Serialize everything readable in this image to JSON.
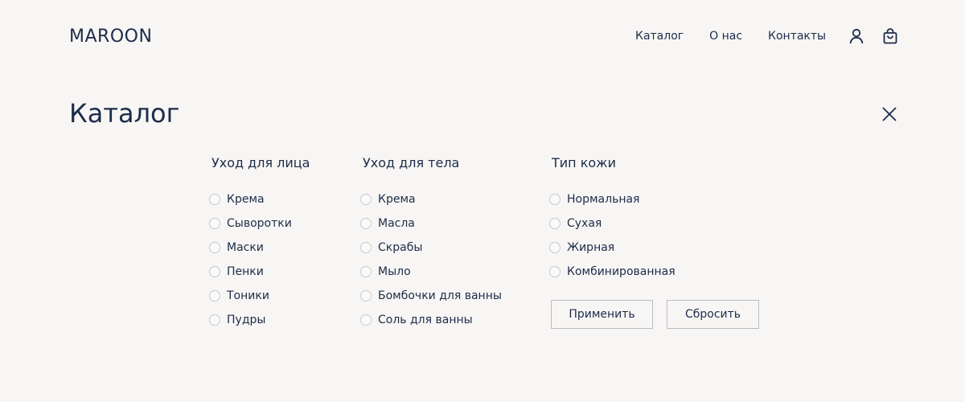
{
  "header": {
    "logo": "MAROON",
    "nav": [
      "Каталог",
      "О нас",
      "Контакты"
    ],
    "icons": [
      "user-icon",
      "shopping-bag-icon"
    ]
  },
  "catalog": {
    "title": "Каталог",
    "close_icon": "close-icon",
    "groups": [
      {
        "title": "Уход для лица",
        "options": [
          "Крема",
          "Сыворотки",
          "Маски",
          "Пенки",
          "Тоники",
          "Пудры"
        ]
      },
      {
        "title": "Уход для тела",
        "options": [
          "Крема",
          "Масла",
          "Скрабы",
          "Мыло",
          "Бомбочки для ванны",
          "Соль для ванны"
        ]
      },
      {
        "title": "Тип кожи",
        "options": [
          "Нормальная",
          "Сухая",
          "Жирная",
          "Комбинированная"
        ]
      }
    ],
    "apply_label": "Применить",
    "reset_label": "Сбросить"
  },
  "colors": {
    "background": "#f8f6f4",
    "text": "#1c2c4a",
    "border": "#b9bcc4"
  }
}
